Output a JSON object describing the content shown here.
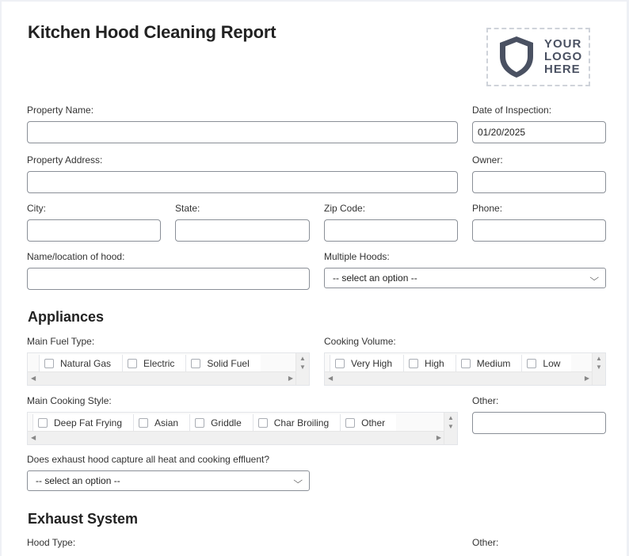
{
  "title": "Kitchen Hood Cleaning Report",
  "logo": {
    "line1": "YOUR",
    "line2": "LOGO",
    "line3": "HERE"
  },
  "fields": {
    "property_name": {
      "label": "Property Name:",
      "value": ""
    },
    "date_of_inspection": {
      "label": "Date of Inspection:",
      "value": "01/20/2025"
    },
    "property_address": {
      "label": "Property Address:",
      "value": ""
    },
    "owner": {
      "label": "Owner:",
      "value": ""
    },
    "city": {
      "label": "City:",
      "value": ""
    },
    "state": {
      "label": "State:",
      "value": ""
    },
    "zip": {
      "label": "Zip Code:",
      "value": ""
    },
    "phone": {
      "label": "Phone:",
      "value": ""
    },
    "hood_location": {
      "label": "Name/location of hood:",
      "value": ""
    },
    "multiple_hoods": {
      "label": "Multiple Hoods:",
      "selected": "-- select an option --"
    }
  },
  "appliances": {
    "heading": "Appliances",
    "main_fuel_type": {
      "label": "Main Fuel Type:",
      "options": [
        "Natural Gas",
        "Electric",
        "Solid Fuel"
      ]
    },
    "cooking_volume": {
      "label": "Cooking Volume:",
      "options": [
        "Very High",
        "High",
        "Medium",
        "Low"
      ]
    },
    "main_cooking_style": {
      "label": "Main Cooking Style:",
      "options": [
        "Deep Fat Frying",
        "Asian",
        "Griddle",
        "Char Broiling",
        "Other"
      ]
    },
    "other": {
      "label": "Other:",
      "value": ""
    },
    "exhaust_capture": {
      "label": "Does exhaust hood capture all heat and cooking effluent?",
      "selected": "-- select an option --"
    }
  },
  "exhaust_system": {
    "heading": "Exhaust System",
    "hood_type_label": "Hood Type:",
    "other_label": "Other:"
  }
}
